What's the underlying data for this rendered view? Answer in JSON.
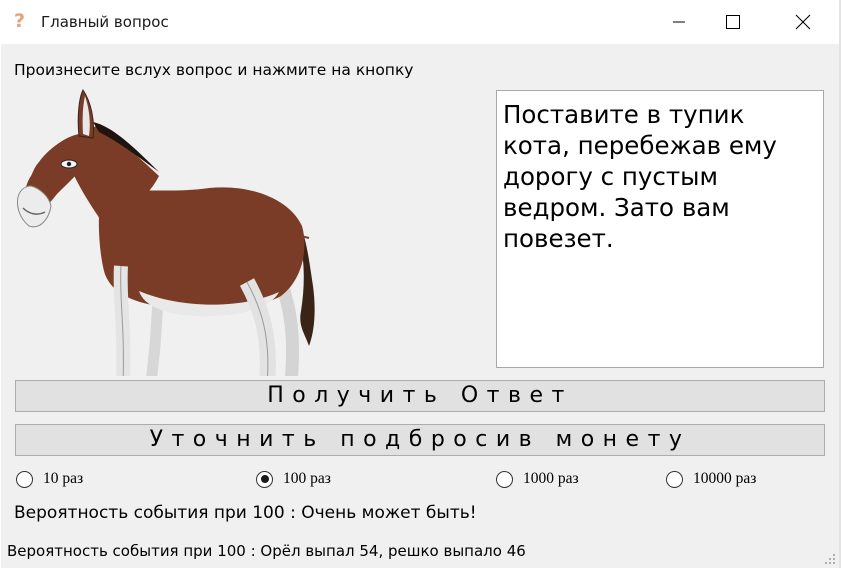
{
  "window": {
    "title": "Главный вопрос",
    "icon": "question-icon",
    "icon_glyph": "?",
    "controls": [
      "minimize-icon",
      "maximize-icon",
      "close-icon"
    ]
  },
  "main": {
    "prompt": "Произнесите вслух вопрос и нажмите на кнопку",
    "image": "donkey-illustration",
    "answer_text": "Поставите в тупик кота, перебежав ему дорогу с пустым ведром. Зато вам повезет.",
    "get_answer_button": "Получить Ответ",
    "coin_button": "Уточнить подбросив монету",
    "radio_options": [
      {
        "label": "10 раз",
        "selected": false
      },
      {
        "label": "100 раз",
        "selected": true
      },
      {
        "label": "1000 раз",
        "selected": false
      },
      {
        "label": "10000 раз",
        "selected": false
      }
    ],
    "result": "Вероятность события при 100 : Очень может быть!"
  },
  "statusbar": {
    "text": "Вероятность события при 100 : Орёл выпал 54, решко выпало 46"
  },
  "colors": {
    "window_bg": "#f0f0f0",
    "button_bg": "#e1e1e1",
    "button_border": "#adadad",
    "icon_accent": "#e6a07a"
  }
}
